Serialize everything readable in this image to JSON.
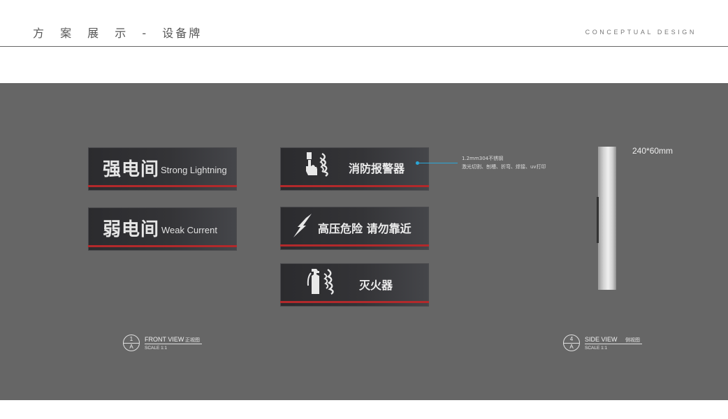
{
  "header": {
    "title": "方 案 展 示 -",
    "subtitle": "设备牌",
    "tag": "CONCEPTUAL DESIGN"
  },
  "signs": {
    "strong": {
      "cn": "强电间",
      "en": "Strong Lightning"
    },
    "weak": {
      "cn": "弱电间",
      "en": "Weak Current"
    },
    "fire_alarm": {
      "label": "消防报警器",
      "icon": "fire-alarm-button-icon"
    },
    "high_voltage": {
      "label": "高压危险  请勿靠近",
      "icon": "lightning-bolt-icon"
    },
    "extinguisher": {
      "label": "灭火器",
      "icon": "fire-extinguisher-icon"
    }
  },
  "annotation": {
    "line1": "1.2mm304不锈钢",
    "line2": "激光切割、刨槽、折弯、焊接、uv打印"
  },
  "side": {
    "dimension": "240*60mm"
  },
  "front_view": {
    "top": "1",
    "bottom": "A",
    "title": "FRONT VIEW",
    "cn": "正视图",
    "scale": "SCALE 1:1"
  },
  "side_view": {
    "top": "4",
    "bottom": "A",
    "title": "SIDE VIEW",
    "cn": "侧视图",
    "scale": "SCALE 1:1"
  },
  "colors": {
    "stage": "#666666",
    "accent_red": "#b2292b",
    "leader_blue": "#2aa7d8"
  }
}
